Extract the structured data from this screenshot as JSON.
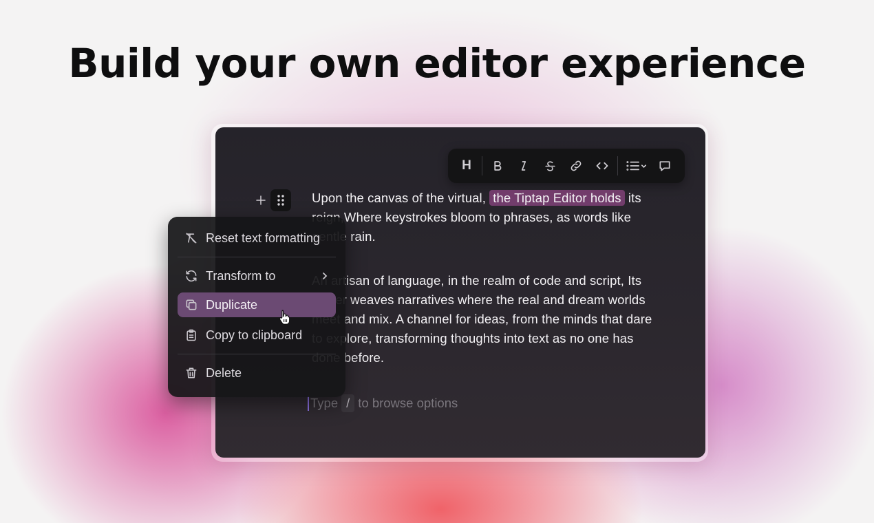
{
  "headline": "Build your own editor experience",
  "toolbar": {
    "heading_label": "H",
    "items": [
      "heading-icon",
      "bold-icon",
      "italic-icon",
      "strikethrough-icon",
      "link-icon",
      "code-icon",
      "list-icon",
      "chevron-down-icon",
      "comment-icon"
    ]
  },
  "editor": {
    "paragraph1_before": "Upon the canvas of the virtual, ",
    "paragraph1_highlight": "the Tiptap Editor holds",
    "paragraph1_after": " its reign,Where keystrokes bloom to phrases, as words like gentle rain.",
    "paragraph2": "An artisan of language, in the realm of code and script, Its power weaves narratives where the real and dream worlds meet and mix. A channel for ideas, from the minds that dare to explore, transforming thoughts into text as no one has done before.",
    "placeholder_before": "Type",
    "placeholder_key": "/",
    "placeholder_after": "to browse options"
  },
  "context_menu": {
    "items": [
      {
        "label": "Reset text formatting",
        "icon": "remove-formatting-icon"
      },
      {
        "label": "Transform to",
        "icon": "refresh-icon",
        "has_submenu": true
      },
      {
        "label": "Duplicate",
        "icon": "copy-icon",
        "active": true
      },
      {
        "label": "Copy to clipboard",
        "icon": "clipboard-icon"
      },
      {
        "label": "Delete",
        "icon": "trash-icon"
      }
    ]
  },
  "colors": {
    "menu_highlight": "#6b4a73",
    "text_highlight": "#8c4682",
    "caret": "#8a6fe0"
  }
}
